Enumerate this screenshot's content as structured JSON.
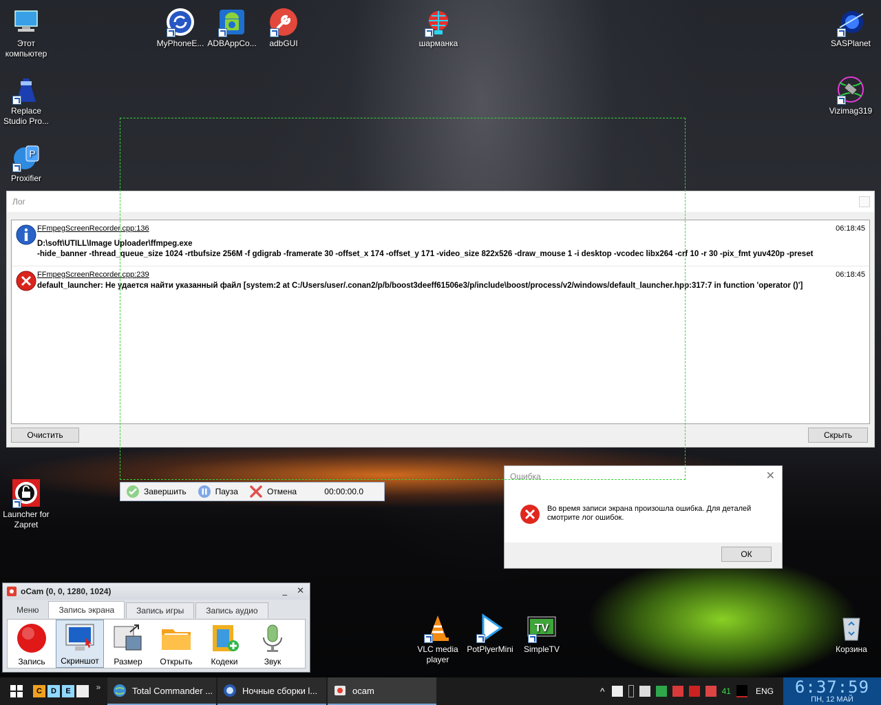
{
  "desktop": {
    "icons": [
      {
        "id": "this-pc",
        "label": "Этот компьютер"
      },
      {
        "id": "replace-studio",
        "label": "Replace Studio Pro..."
      },
      {
        "id": "proxifier",
        "label": "Proxifier"
      },
      {
        "id": "launcher-zapret",
        "label": "Launcher for Zapret"
      },
      {
        "id": "myphone",
        "label": "MyPhoneE..."
      },
      {
        "id": "adbappco",
        "label": "ADBAppCo..."
      },
      {
        "id": "adbgui",
        "label": "adbGUI"
      },
      {
        "id": "sharmanka",
        "label": "шарманка"
      },
      {
        "id": "sasplanet",
        "label": "SASPlanet"
      },
      {
        "id": "vizimag",
        "label": "Vizimag319"
      },
      {
        "id": "vlc",
        "label": "VLC media player"
      },
      {
        "id": "potplayer",
        "label": "PotPlyerMini"
      },
      {
        "id": "simpletv",
        "label": "SimpleTV"
      },
      {
        "id": "recycle",
        "label": "Корзина"
      }
    ]
  },
  "log_window": {
    "title": "Лог",
    "entries": [
      {
        "source": "FFmpegScreenRecorder.cpp:136",
        "time": "06:18:45",
        "line1": "D:\\soft\\UTILL\\Image Uploader\\ffmpeg.exe",
        "line2": "-hide_banner -thread_queue_size 1024 -rtbufsize 256M -f gdigrab -framerate 30 -offset_x 174 -offset_y 171 -video_size 822x526 -draw_mouse 1 -i desktop -vcodec libx264 -crf 10 -r 30 -pix_fmt yuv420p -preset"
      },
      {
        "source": "FFmpegScreenRecorder.cpp:239",
        "time": "06:18:45",
        "line1": "default_launcher: Не удается найти указанный файл [system:2 at C:/Users/user/.conan2/p/b/boost3deeff61506e3/p/include\\boost/process/v2/windows/default_launcher.hpp:317:7 in function 'operator ()']"
      }
    ],
    "clear_button": "Очистить",
    "hide_button": "Скрыть"
  },
  "record_toolbar": {
    "finish": "Завершить",
    "pause": "Пауза",
    "cancel": "Отмена",
    "timer": "00:00:00.0"
  },
  "error_dialog": {
    "title": "Ошибка",
    "message": "Во время записи экрана произошла ошибка. Для деталей смотрите лог ошибок.",
    "ok_button": "ОК"
  },
  "ocam": {
    "title": "oCam (0, 0, 1280, 1024)",
    "tabs": [
      "Меню",
      "Запись экрана",
      "Запись игры",
      "Запись аудио"
    ],
    "active_tab": "Запись экрана",
    "tools": [
      "Запись",
      "Скриншот",
      "Размер",
      "Открыть",
      "Кодеки",
      "Звук"
    ]
  },
  "taskbar": {
    "quick_launch": [
      "C",
      "D",
      "E"
    ],
    "tasks": [
      "Total Commander ...",
      "Ночные сборки l...",
      "ocam"
    ],
    "tray_number": "41",
    "language": "ENG",
    "clock_time": "6:37:59",
    "clock_date": "ПН, 12 МАЙ"
  },
  "colors": {
    "record_frame": "#36d436",
    "error_red": "#d9251c",
    "info_blue": "#2a63c7",
    "clock_bg": "#0c4a8a"
  }
}
